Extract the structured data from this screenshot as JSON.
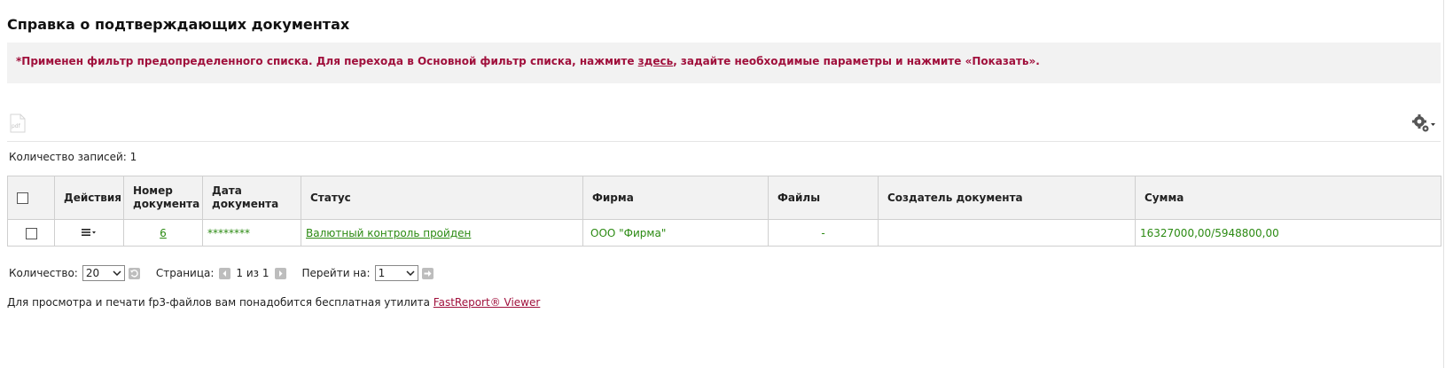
{
  "page": {
    "title": "Справка о подтверждающих документах",
    "notice": {
      "prefix": "*Применен фильтр предопределенного списка. Для перехода в Основной фильтр списка, нажмите ",
      "link": "здесь",
      "suffix": ", задайте необходимые параметры и нажмите «Показать»."
    },
    "toolbar": {
      "pdf_label": "pdf",
      "settings_icon": "gear-icon"
    },
    "record_count": "Количество записей: 1"
  },
  "table": {
    "columns": [
      "Действия",
      "Номер документа",
      "Дата документа",
      "Статус",
      "Фирма",
      "Файлы",
      "Создатель документа",
      "Сумма"
    ],
    "rows": [
      {
        "actions_icon": "menu-icon",
        "number": "6",
        "date": "********",
        "status": "Валютный контроль пройден",
        "firm": "ООО \"Фирма\"",
        "files": "-",
        "creator": "",
        "sum": "16327000,00/5948800,00"
      }
    ]
  },
  "pager": {
    "count_label": "Количество:",
    "count_value": "20",
    "page_label": "Страница:",
    "page_info": "1 из 1",
    "goto_label": "Перейти на:",
    "goto_value": "1"
  },
  "footer": {
    "text": "Для просмотра и печати fp3-файлов вам понадобится бесплатная утилита ",
    "link": "FastReport® Viewer"
  },
  "colors": {
    "notice_text": "#a0103c",
    "link_green": "#2b8a12",
    "header_bg": "#f2f2f2"
  }
}
